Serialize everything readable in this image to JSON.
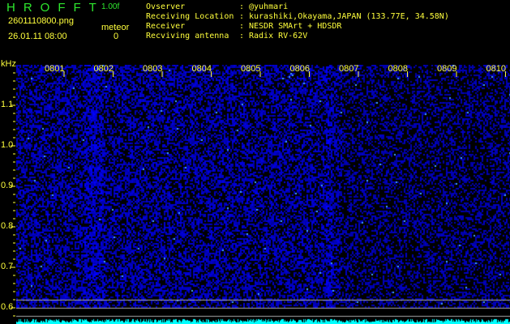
{
  "app": {
    "logo": "HROFFT",
    "version": "1.00f"
  },
  "file": {
    "name": "2601110800.png",
    "datetime": "26.01.11 08:00"
  },
  "meteor": {
    "label": "meteor",
    "count": "0"
  },
  "info": [
    {
      "label": "Ovserver",
      "value": "@yuhmari"
    },
    {
      "label": "Receiving Location",
      "value": "kurashiki,Okayama,JAPAN (133.77E, 34.58N)"
    },
    {
      "label": "Receiver",
      "value": "NESDR SMArt + HDSDR"
    },
    {
      "label": "Recviving antenna",
      "value": "Radix RV-62V"
    }
  ],
  "axis": {
    "unit": "kHz",
    "y_ticks": [
      "1.1",
      "1.0",
      "0.9",
      "0.8",
      "0.7",
      "0.6"
    ],
    "time_ticks": [
      "0801",
      "0802",
      "0803",
      "0804",
      "0805",
      "0806",
      "0807",
      "0808",
      "0809",
      "0810"
    ]
  },
  "colors": {
    "logo": "#2ee82e",
    "text": "#ffff3c",
    "signal": "#00ffff",
    "noise": "#2020c0"
  }
}
